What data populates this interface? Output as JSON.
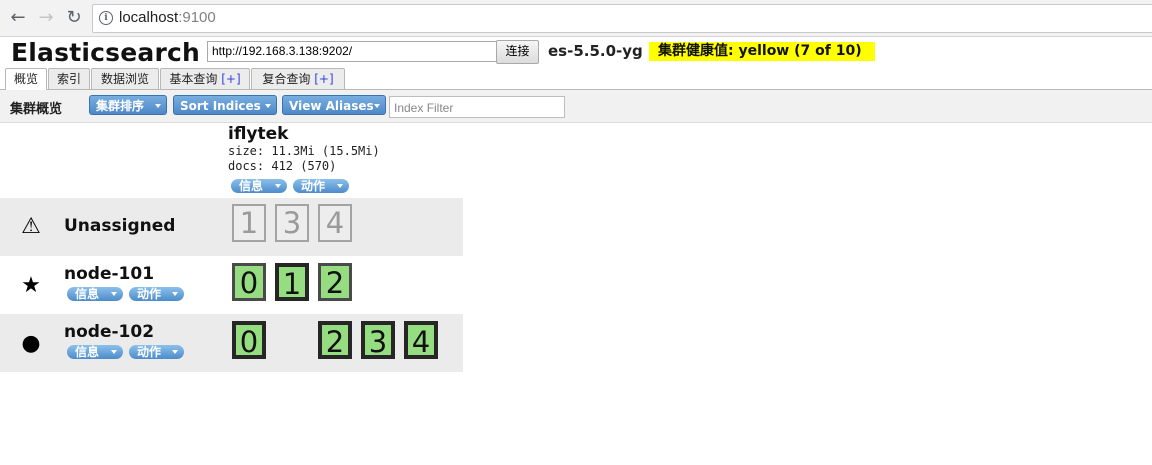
{
  "browser": {
    "url_host": "localhost",
    "url_port": ":9100",
    "back_glyph": "arrow-left-icon",
    "forward_glyph": "arrow-right-icon",
    "reload_glyph": "reload-icon"
  },
  "header": {
    "title": "Elasticsearch",
    "connection_url": "http://192.168.3.138:9202/",
    "connect_label": "连接",
    "cluster_name": "es-5.5.0-yg",
    "health_text": "集群健康值: yellow (7 of 10)",
    "health_color": "#ffff00"
  },
  "tabs": [
    {
      "label": "概览",
      "plus": ""
    },
    {
      "label": "索引",
      "plus": ""
    },
    {
      "label": "数据浏览",
      "plus": ""
    },
    {
      "label": "基本查询 ",
      "plus": "[+]"
    },
    {
      "label": "复合查询 ",
      "plus": "[+]"
    }
  ],
  "toolbar": {
    "title": "集群概览",
    "sort_cluster": "集群排序",
    "sort_indices": "Sort Indices",
    "view_aliases": "View Aliases",
    "filter_placeholder": "Index Filter"
  },
  "index": {
    "name": "iflytek",
    "size": "size: 11.3Mi (15.5Mi)",
    "docs": "docs: 412 (570)",
    "info_label": "信息",
    "action_label": "动作"
  },
  "nodes": [
    {
      "name": "Unassigned",
      "icon": "warning-icon",
      "shards": [
        {
          "id": "1",
          "state": "unassigned"
        },
        {
          "id": "3",
          "state": "unassigned"
        },
        {
          "id": "4",
          "state": "unassigned"
        }
      ]
    },
    {
      "name": "node-101",
      "icon": "star-icon",
      "master": true,
      "info_label": "信息",
      "action_label": "动作",
      "shards": [
        {
          "id": "0",
          "state": "replica"
        },
        {
          "id": "1",
          "state": "primary"
        },
        {
          "id": "2",
          "state": "replica"
        }
      ]
    },
    {
      "name": "node-102",
      "icon": "circle-icon",
      "info_label": "信息",
      "action_label": "动作",
      "shards": [
        {
          "id": "0",
          "state": "primary"
        },
        {
          "id": "2",
          "state": "primary"
        },
        {
          "id": "3",
          "state": "primary"
        },
        {
          "id": "4",
          "state": "primary"
        }
      ]
    }
  ]
}
